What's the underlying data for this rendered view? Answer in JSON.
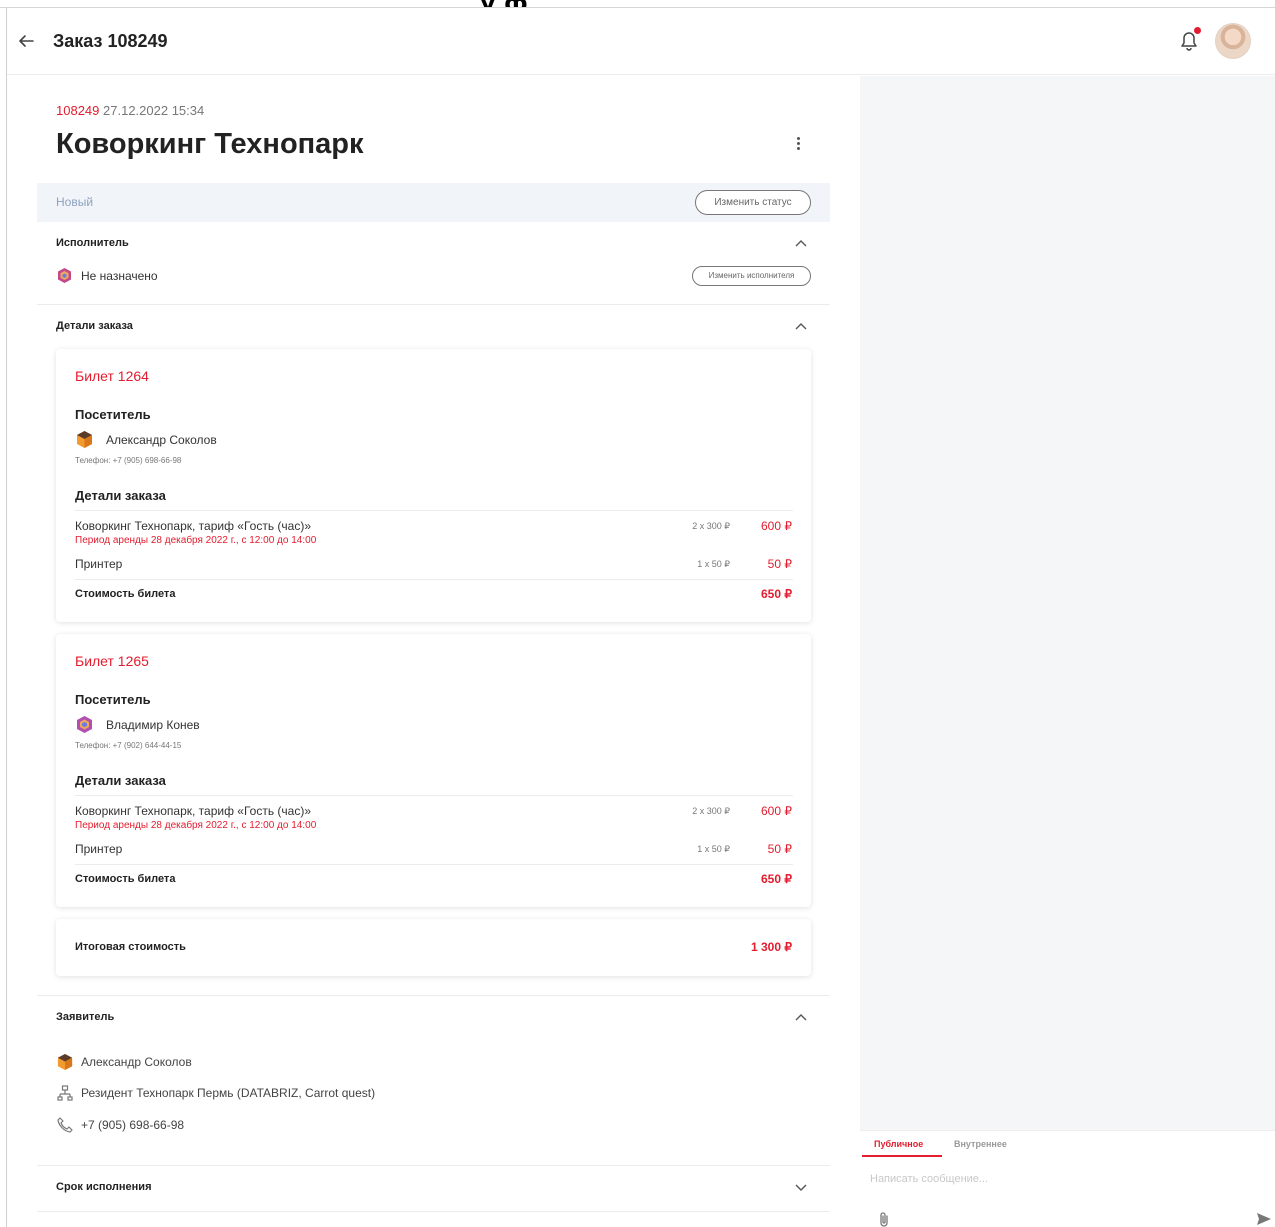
{
  "header": {
    "title": "Заказ 108249"
  },
  "order": {
    "number": "108249",
    "datetime": "27.12.2022 15:34",
    "name": "Коворкинг Технопарк"
  },
  "status": {
    "value": "Новый",
    "change_label": "Изменить статус"
  },
  "assignee": {
    "section_title": "Исполнитель",
    "value": "Не назначено",
    "change_label": "Изменить исполнителя"
  },
  "details": {
    "section_title": "Детали заказа",
    "tickets": [
      {
        "title": "Билет 1264",
        "visitor_heading": "Посетитель",
        "visitor_name": "Александр Соколов",
        "visitor_phone": "Телефон: +7 (905) 698-66-98",
        "details_heading": "Детали заказа",
        "items": [
          {
            "name": "Коворкинг Технопарк, тариф «Гость (час)»",
            "sub": "Период аренды 28 декабря 2022 г., с 12:00 до 14:00",
            "qty": "2 x 300 ₽",
            "price": "600 ₽"
          },
          {
            "name": "Принтер",
            "sub": "",
            "qty": "1 x 50 ₽",
            "price": "50 ₽"
          }
        ],
        "total_label": "Стоимость билета",
        "total": "650 ₽"
      },
      {
        "title": "Билет 1265",
        "visitor_heading": "Посетитель",
        "visitor_name": "Владимир Конев",
        "visitor_phone": "Телефон: +7 (902) 644-44-15",
        "details_heading": "Детали заказа",
        "items": [
          {
            "name": "Коворкинг Технопарк, тариф «Гость (час)»",
            "sub": "Период аренды 28 декабря 2022 г., с 12:00 до 14:00",
            "qty": "2 x 300 ₽",
            "price": "600 ₽"
          },
          {
            "name": "Принтер",
            "sub": "",
            "qty": "1 x 50 ₽",
            "price": "50 ₽"
          }
        ],
        "total_label": "Стоимость билета",
        "total": "650 ₽"
      }
    ],
    "grand_total_label": "Итоговая стоимость",
    "grand_total": "1 300 ₽"
  },
  "applicant": {
    "section_title": "Заявитель",
    "name": "Александр Соколов",
    "organization": "Резидент Технопарк Пермь (DATABRIZ, Carrot quest)",
    "phone": "+7 (905) 698-66-98"
  },
  "deadline": {
    "section_title": "Срок исполнения"
  },
  "chat": {
    "tab_public": "Публичное",
    "tab_internal": "Внутреннее",
    "placeholder": "Написать сообщение..."
  },
  "colors": {
    "accent": "#e31c2e",
    "status_bar": "#f1f4f8",
    "status_text": "#8da2c0",
    "panel": "#f4f6f8"
  },
  "icons": [
    "back-arrow-icon",
    "bell-icon",
    "kebab-menu-icon",
    "chevron-up-icon",
    "chevron-down-icon",
    "company-icon",
    "phone-icon",
    "paperclip-icon",
    "send-icon"
  ]
}
